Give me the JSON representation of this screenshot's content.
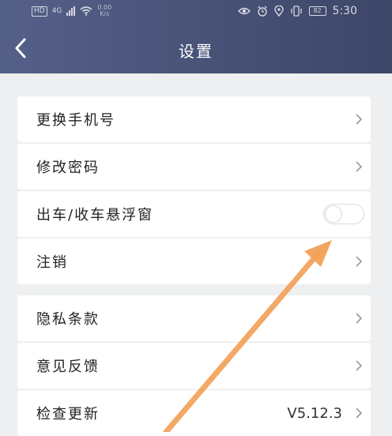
{
  "status_bar": {
    "left_badge": "HD",
    "network": "4G",
    "speed_value": "0.00",
    "speed_unit": "K/s",
    "battery": "82",
    "time": "5:30"
  },
  "header": {
    "title": "设置",
    "back_icon": "chevron-left-icon"
  },
  "settings": {
    "group1": [
      {
        "label": "更换手机号"
      },
      {
        "label": "修改密码"
      },
      {
        "label": "出车/收车悬浮窗",
        "toggle_on": false
      },
      {
        "label": "注销"
      }
    ],
    "group2": [
      {
        "label": "隐私条款"
      },
      {
        "label": "意见反馈"
      },
      {
        "label": "检查更新",
        "value": "V5.12.3"
      }
    ]
  },
  "colors": {
    "header_start": "#556089",
    "header_end": "#3d4668",
    "background": "#eeeff1",
    "annotation_arrow": "#f2a15a"
  }
}
